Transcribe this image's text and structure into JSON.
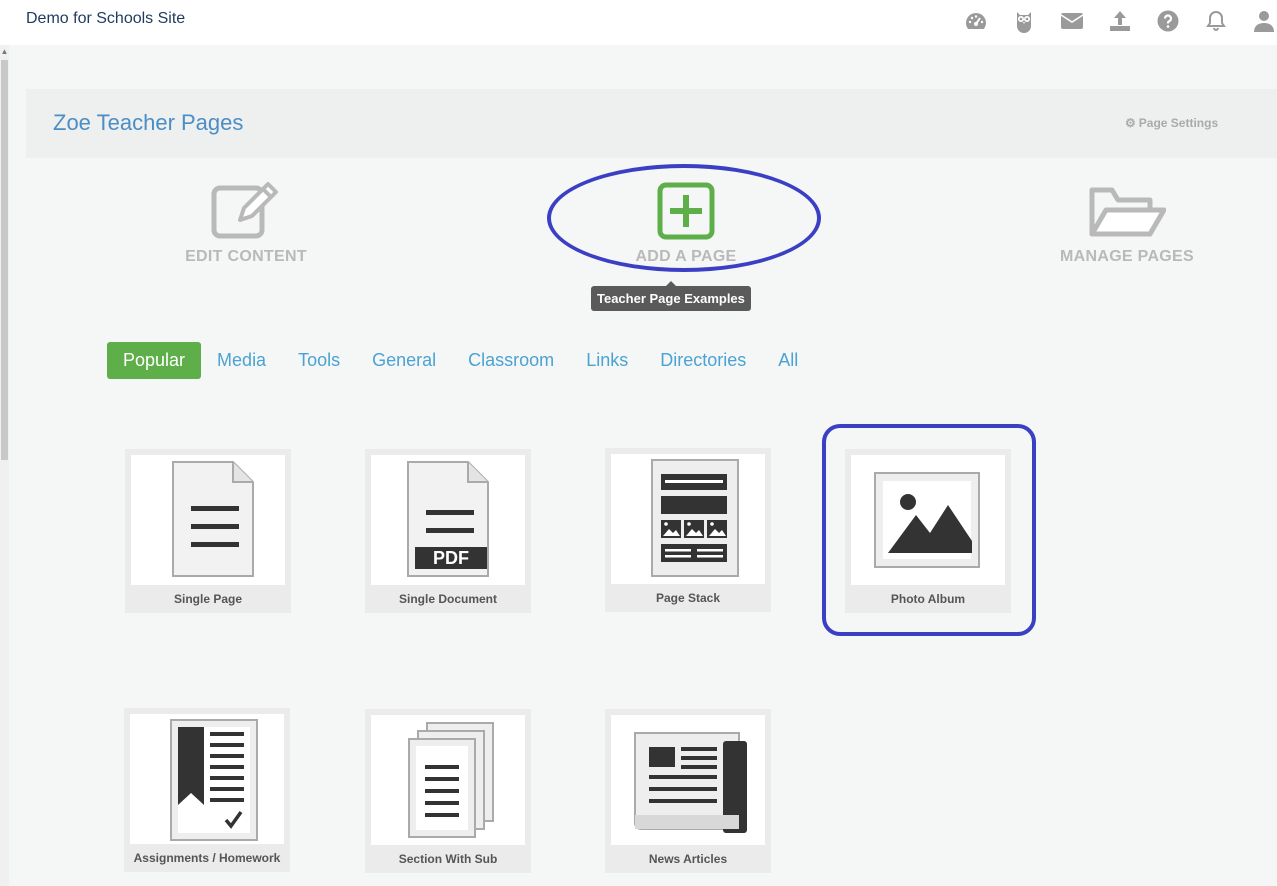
{
  "topbar": {
    "site_name": "Demo for Schools Site",
    "icons": [
      "dashboard-icon",
      "owl-icon",
      "mail-icon",
      "upload-icon",
      "help-icon",
      "bell-icon",
      "user-icon"
    ]
  },
  "page": {
    "title": "Zoe Teacher Pages",
    "settings_label": "Page Settings"
  },
  "actions": {
    "edit": "EDIT CONTENT",
    "add": "ADD A PAGE",
    "manage": "MANAGE PAGES"
  },
  "tooltip": "Teacher Page Examples",
  "tabs": [
    "Popular",
    "Media",
    "Tools",
    "General",
    "Classroom",
    "Links",
    "Directories",
    "All"
  ],
  "tiles": [
    {
      "label": "Single Page"
    },
    {
      "label": "Single Document",
      "badge": "PDF"
    },
    {
      "label": "Page Stack"
    },
    {
      "label": "Photo Album"
    },
    {
      "label": "Assignments / Homework"
    },
    {
      "label": "Section With Sub"
    },
    {
      "label": "News Articles"
    }
  ],
  "colors": {
    "accent_blue": "#4b8ec6",
    "tab_link": "#4aa3d3",
    "active_tab": "#5eae49",
    "highlight": "#3a3fc4",
    "add_icon": "#5eae49"
  }
}
